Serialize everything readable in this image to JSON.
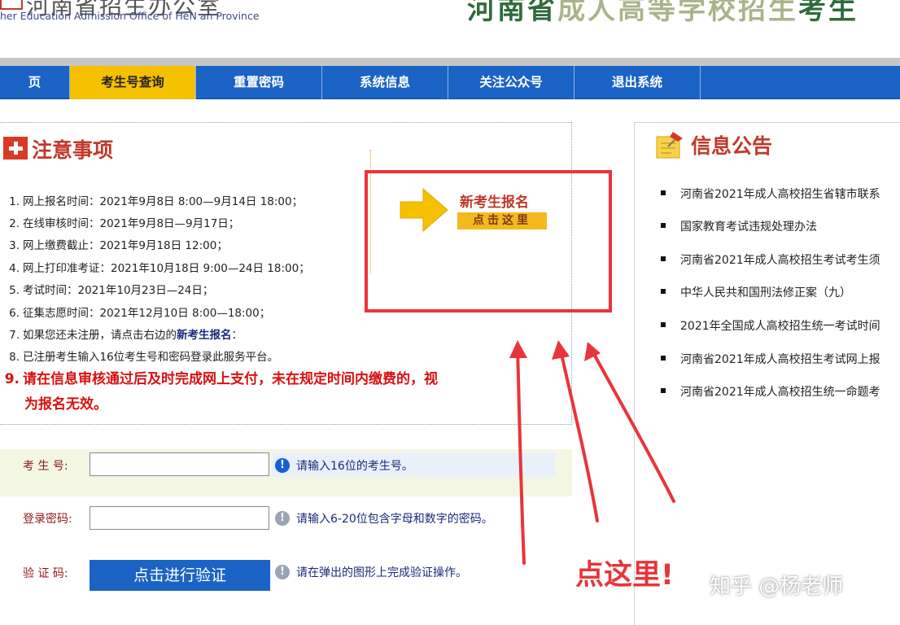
{
  "header": {
    "org_cn": "河南省招生办公室",
    "org_en": "her Education Admission Office of HeN an Province",
    "banner_part1": "河南省",
    "banner_part2": "成人高等学校招生",
    "banner_part3": "考生"
  },
  "nav": {
    "items": [
      {
        "label": "页"
      },
      {
        "label": "考生号查询"
      },
      {
        "label": "重置密码"
      },
      {
        "label": "系统信息"
      },
      {
        "label": "关注公众号"
      },
      {
        "label": "退出系统"
      }
    ],
    "active_index": 1,
    "color": "#1b63c4",
    "active_color": "#f5c000"
  },
  "notice": {
    "title": "注意事项",
    "items": [
      {
        "num": "1.",
        "text": "网上报名时间：2021年9月8日 8:00—9月14日 18:00；"
      },
      {
        "num": "2.",
        "text": "在线审核时间：2021年9月8日—9月17日；"
      },
      {
        "num": "3.",
        "text": "网上缴费截止：2021年9月18日 12:00；"
      },
      {
        "num": "4.",
        "text": "网上打印准考证：2021年10月18日 9:00—24日 18:00；"
      },
      {
        "num": "5.",
        "text": "考试时间：2021年10月23日—24日；"
      },
      {
        "num": "6.",
        "text": "征集志愿时间：2021年12月10日 8:00—18:00；"
      },
      {
        "num": "7.",
        "text_before": "如果您还未注册，请点击右边的",
        "text_strong": "新考生报名",
        "text_after": "："
      },
      {
        "num": "8.",
        "text": "已注册考生输入16位考生号和密码登录此服务平台。"
      },
      {
        "num": "9.",
        "text": "请在信息审核通过后及时完成网上支付，未在规定时间内缴费的，视",
        "text_cont": "为报名无效。"
      }
    ]
  },
  "register": {
    "title": "新考生报名",
    "button_label": "点击这里"
  },
  "info": {
    "title": "信息公告",
    "items": [
      "河南省2021年成人高校招生省辖市联系",
      "国家教育考试违规处理办法",
      "河南省2021年成人高校招生考试考生须",
      "中华人民共和国刑法修正案（九）",
      "2021年全国成人高校招生统一考试时间",
      "河南省2021年成人高校招生考试网上报",
      "河南省2021年成人高校招生统一命题考"
    ]
  },
  "login": {
    "exam_no_label": "考 生 号:",
    "exam_no_value": "",
    "exam_no_hint": "请输入16位的考生号。",
    "password_label": "登录密码:",
    "password_value": "",
    "password_hint": "请输入6-20位包含字母和数字的密码。",
    "captcha_label": "验 证 码:",
    "captcha_button": "点击进行验证",
    "captcha_hint": "请在弹出的图形上完成验证操作。",
    "hint_icon_glyph": "!"
  },
  "annotation": {
    "text": "点这里!",
    "color": "#e8353b"
  },
  "watermark": {
    "text": "知乎 @杨老师"
  }
}
